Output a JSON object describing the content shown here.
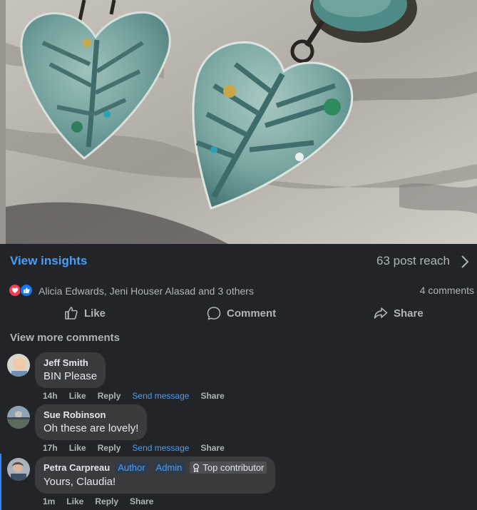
{
  "post": {
    "insights_label": "View insights",
    "reach_label": "63 post reach",
    "reactors_text": "Alicia Edwards, Jeni Houser Alasad and 3 others",
    "comment_count": "4 comments",
    "actions": {
      "like": "Like",
      "comment": "Comment",
      "share": "Share"
    },
    "view_more_comments": "View more comments",
    "reaction_icons": [
      "love-icon",
      "like-icon"
    ]
  },
  "comments": [
    {
      "author": "Jeff Smith",
      "text": "BIN Please",
      "time": "14h",
      "like": "Like",
      "reply": "Reply",
      "send_message": "Send message",
      "share": "Share"
    },
    {
      "author": "Sue Robinson",
      "text": "Oh these are lovely!",
      "time": "17h",
      "like": "Like",
      "reply": "Reply",
      "send_message": "Send message",
      "share": "Share"
    },
    {
      "author": "Petra Carpreau",
      "badges": [
        "Author",
        "Admin",
        "Top contributor"
      ],
      "text": "Yours, Claudia!",
      "time": "1m",
      "like": "Like",
      "reply": "Reply",
      "share": "Share"
    }
  ],
  "colors": {
    "background": "#232427",
    "accent": "#4a9ef5",
    "bubble": "#3a3b3c",
    "muted_text": "#b0b3b8"
  }
}
